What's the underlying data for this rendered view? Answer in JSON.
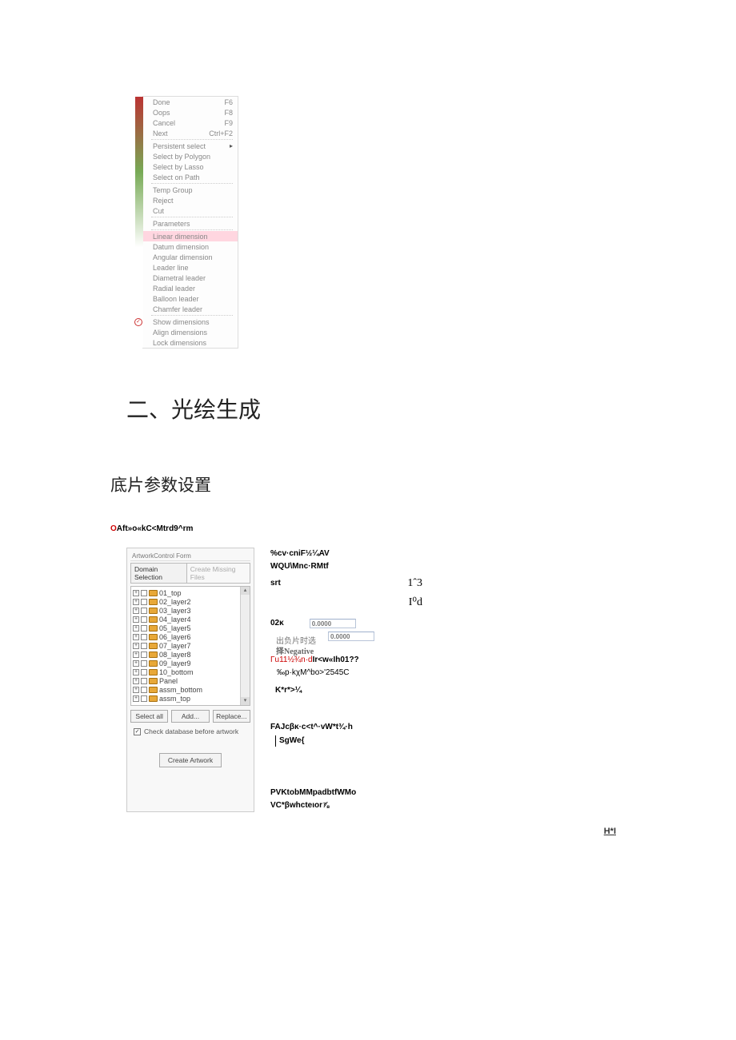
{
  "context_menu": {
    "groups": [
      [
        {
          "label": "Done",
          "shortcut": "F6"
        },
        {
          "label": "Oops",
          "shortcut": "F8"
        },
        {
          "label": "Cancel",
          "shortcut": "F9"
        },
        {
          "label": "Next",
          "shortcut": "Ctrl+F2"
        }
      ],
      [
        {
          "label": "Persistent select",
          "submenu": true
        },
        {
          "label": "Select by Polygon"
        },
        {
          "label": "Select by Lasso"
        },
        {
          "label": "Select on Path"
        }
      ],
      [
        {
          "label": "Temp Group"
        },
        {
          "label": "Reject"
        },
        {
          "label": "Cut"
        }
      ],
      [
        {
          "label": "Parameters"
        }
      ],
      [
        {
          "label": "Linear dimension",
          "highlight": true
        },
        {
          "label": "Datum dimension"
        },
        {
          "label": "Angular dimension"
        },
        {
          "label": "Leader line"
        },
        {
          "label": "Diametral leader"
        },
        {
          "label": "Radial leader"
        },
        {
          "label": "Balloon leader"
        },
        {
          "label": "Chamfer leader"
        }
      ],
      [
        {
          "label": "Show dimensions",
          "checked": true
        },
        {
          "label": "Align dimensions"
        },
        {
          "label": "Lock dimensions"
        }
      ]
    ]
  },
  "heading_section": "二、光绘生成",
  "heading_sub": "底片参数设置",
  "garbled_top": {
    "red": "O",
    "text": "Aft»o«kC<Mtrd9^rm"
  },
  "dialog": {
    "title": "ArtworkControl Form",
    "tabs": {
      "active": "Domain Selection",
      "inactive": "Create Missing Files"
    },
    "layers": [
      "01_top",
      "02_layer2",
      "03_layer3",
      "04_layer4",
      "05_layer5",
      "06_layer6",
      "07_layer7",
      "08_layer8",
      "09_layer9",
      "10_bottom",
      "Panel",
      "assm_bottom",
      "assm_top"
    ],
    "annot1": "出负片时选",
    "annot2": "择Negative",
    "btn_selectall": "Select all",
    "btn_add": "Add...",
    "btn_replace": "Replace...",
    "check_db": "Check database before artwork",
    "btn_create": "Create Artwork"
  },
  "rightcol": {
    "l1": "%cv·cniF½¼AV",
    "l2": "WQU\\Mnc·RMtf",
    "l3a": "srt",
    "l3b": "1ˆ3",
    "l4": "I⁰d",
    "l5a": "02κ",
    "l5b": "0.0000",
    "l5c": "0.0000",
    "l6_red": "Γu11½¾n·d",
    "l6_rest": "Ir<w«Ih01??",
    "l7": "‰p·kχM^bo>'2545C",
    "l8": "K*r*>¼",
    "l9": "FAJcβκ·c<t^·vW*t¾·h",
    "l10": "SgWe{",
    "l11": "PVKtobMMpadbtfWMo",
    "l12": "VC*βwhcteιor⅞"
  },
  "footer": "H*I"
}
